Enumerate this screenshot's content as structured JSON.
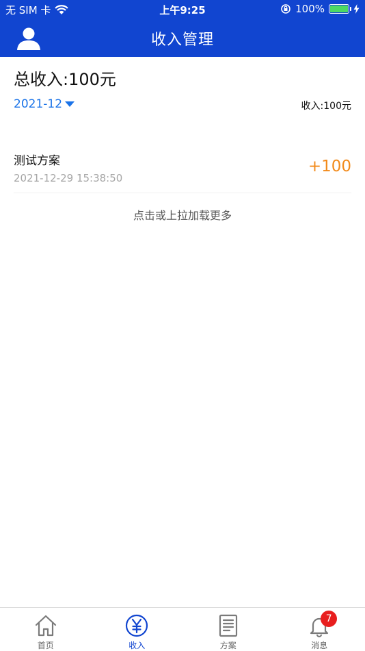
{
  "status_bar": {
    "carrier": "无 SIM 卡",
    "time": "上午9:25",
    "battery_percent": "100%",
    "battery_level": 1.0
  },
  "nav": {
    "title": "收入管理"
  },
  "summary": {
    "total_label": "总收入:100元",
    "month": "2021-12",
    "month_income": "收入:100元"
  },
  "records": [
    {
      "name": "测试方案",
      "time": "2021-12-29 15:38:50",
      "amount": "+100"
    }
  ],
  "load_more": "点击或上拉加载更多",
  "tabs": [
    {
      "label": "首页"
    },
    {
      "label": "收入"
    },
    {
      "label": "方案"
    },
    {
      "label": "消息",
      "badge": "7"
    }
  ],
  "colors": {
    "brand": "#1145d0",
    "accent": "#1a73e8",
    "amount": "#f28a1a",
    "badge": "#e81e1e"
  }
}
